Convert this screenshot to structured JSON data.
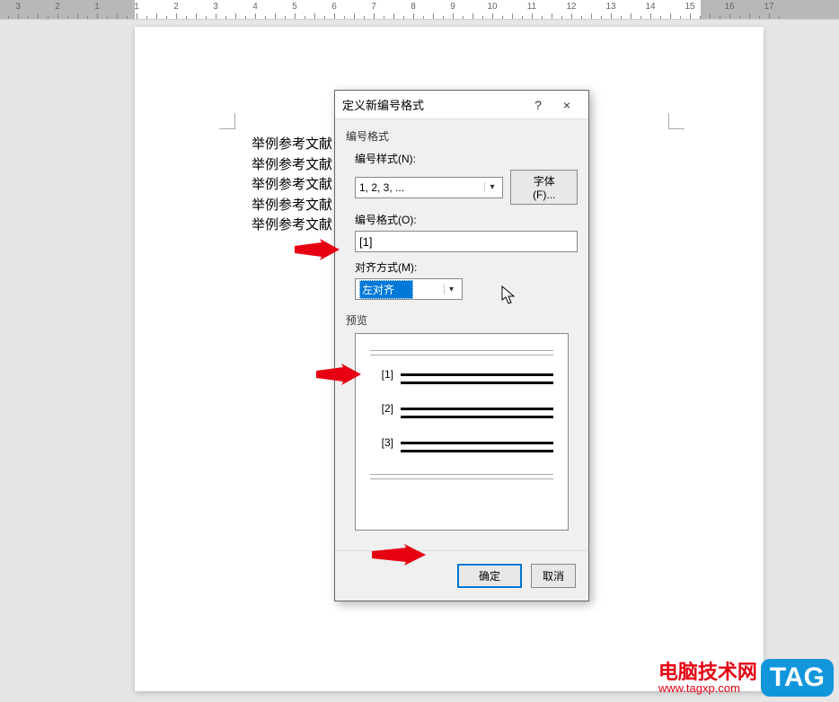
{
  "ruler": {
    "marks": [
      "3",
      "2",
      "1",
      "1",
      "2",
      "3",
      "4",
      "5",
      "6",
      "7",
      "8",
      "9",
      "10",
      "11",
      "12",
      "13",
      "14",
      "15",
      "16",
      "17"
    ]
  },
  "document": {
    "lines": [
      "举例参考文献",
      "举例参考文献",
      "举例参考文献",
      "举例参考文献",
      "举例参考文献"
    ]
  },
  "dialog": {
    "title": "定义新编号格式",
    "help_icon": "?",
    "close_icon": "×",
    "group_number_format": "编号格式",
    "label_style": "编号样式(N):",
    "style_value": "1, 2, 3, ...",
    "font_button": "字体(F)...",
    "label_format": "编号格式(O):",
    "format_value": "[1]",
    "label_align": "对齐方式(M):",
    "align_value": "左对齐",
    "preview_label": "预览",
    "preview_items": [
      "[1]",
      "[2]",
      "[3]"
    ],
    "ok": "确定",
    "cancel": "取消"
  },
  "watermark": {
    "title": "电脑技术网",
    "url": "www.tagxp.com",
    "tag": "TAG"
  }
}
